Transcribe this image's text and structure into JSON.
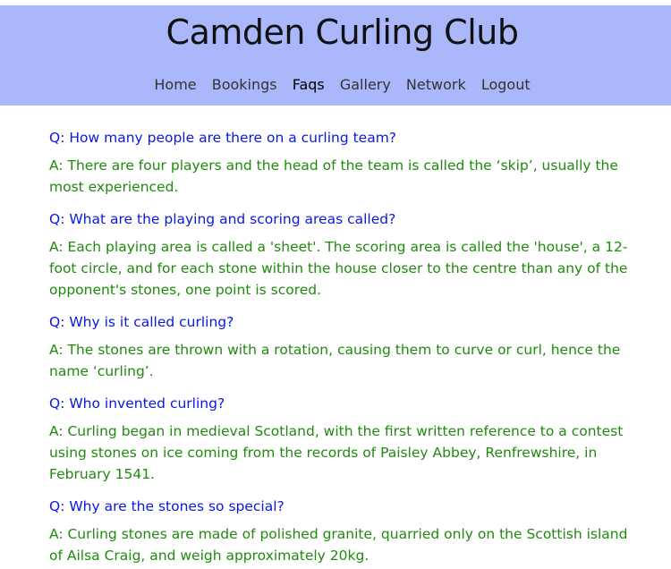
{
  "header": {
    "title": "Camden Curling Club",
    "nav": [
      {
        "label": "Home",
        "active": false
      },
      {
        "label": "Bookings",
        "active": false
      },
      {
        "label": "Faqs",
        "active": true
      },
      {
        "label": "Gallery",
        "active": false
      },
      {
        "label": "Network",
        "active": false
      },
      {
        "label": "Logout",
        "active": false
      }
    ],
    "background_color": "#aab8fb"
  },
  "colors": {
    "question": "#0a18e0",
    "answer": "#1f8a0e"
  },
  "faqs": [
    {
      "question": "Q: How many people are there on a curling team?",
      "answer": "A: There are four players and the head of the team is called the ‘skip’, usually the most experienced."
    },
    {
      "question": "Q: What are the playing and scoring areas called?",
      "answer": "A: Each playing area is called a 'sheet'. The scoring area is called the 'house', a 12-foot circle, and for each stone within the house closer to the centre than any of the opponent's stones, one point is scored."
    },
    {
      "question": "Q: Why is it called curling?",
      "answer": "A: The stones are thrown with a rotation, causing them to curve or curl, hence the name ‘curling’."
    },
    {
      "question": "Q: Who invented curling?",
      "answer": "A: Curling began in medieval Scotland, with the first written reference to a contest using stones on ice coming from the records of Paisley Abbey, Renfrewshire, in February 1541."
    },
    {
      "question": "Q: Why are the stones so special?",
      "answer": "A: Curling stones are made of polished granite, quarried only on the Scottish island of Ailsa Craig, and weigh approximately 20kg."
    }
  ]
}
